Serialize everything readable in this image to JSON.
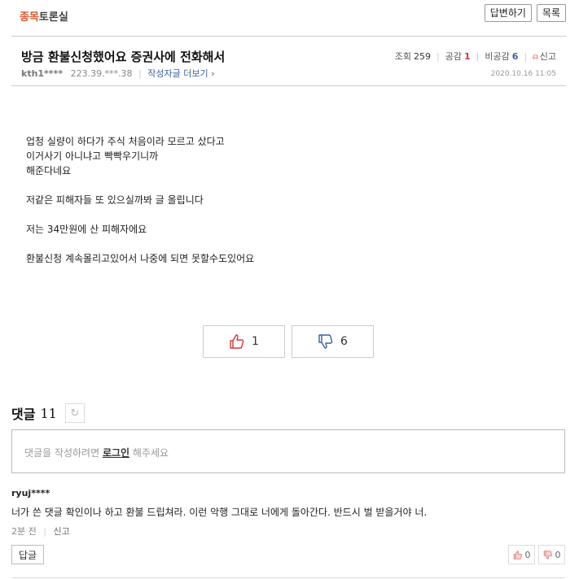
{
  "board": {
    "accent": "종목",
    "rest": "토론실"
  },
  "toolbar": {
    "reply_label": "답변하기",
    "list_label": "목록"
  },
  "post": {
    "title": "방금 환불신청했어요 증권사에 전화해서",
    "author": "kth1****",
    "ip": "223.39.***.38",
    "more_label": "작성자글 더보기 ›",
    "views_label": "조회",
    "views": "259",
    "likes_label": "공감",
    "likes": "1",
    "dislikes_label": "비공감",
    "dislikes": "6",
    "report_label": "신고",
    "date": "2020.10.16 11:05",
    "body": [
      "업청 실량이 하다가 주식 처음이라 모르고 샀다고",
      "이거사기 아니냐고 빡빡우기니까",
      "해준다네요",
      "",
      "저같은 피해자들 또 있으실까봐 글 올립니다",
      "",
      "저는 34만원에 산 피해자에요",
      "",
      "환불신청 계속몰리고있어서 나중에 되면 못할수도있어요"
    ],
    "vote_up": "1",
    "vote_down": "6"
  },
  "comments": {
    "label": "댓글",
    "count": "11",
    "input_prefix": "댓글을 작성하려면 ",
    "input_login": "로그인",
    "input_suffix": " 해주세요",
    "items": [
      {
        "author": "ryuj****",
        "text": "너가 쓴 댓글 확인이나 하고 환불 드립쳐라. 이런 악행 그대로 너에게 돌아간다. 반드시 벌 받을거야 너.",
        "time": "2분 전",
        "report": "신고",
        "reply": "답글",
        "up": "0",
        "down": "0"
      }
    ]
  },
  "colors": {
    "accent": "#e0572b",
    "like": "#d33",
    "dislike": "#3a5ea7"
  }
}
